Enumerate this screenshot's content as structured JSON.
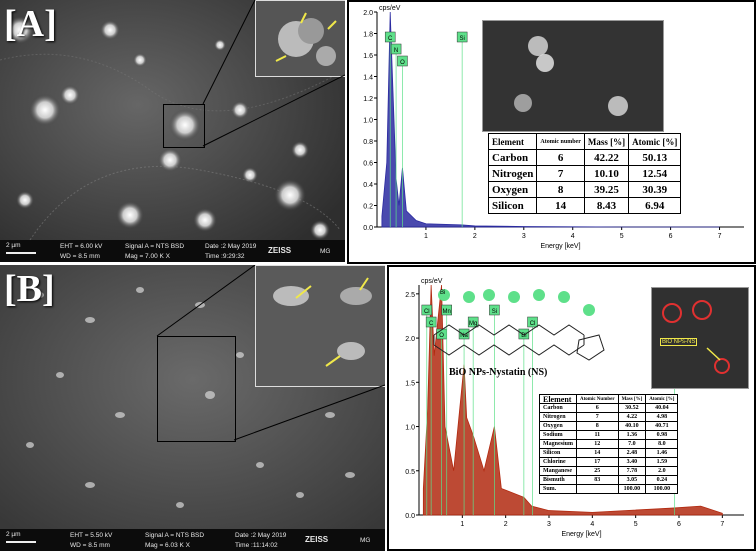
{
  "panel_a": {
    "label": "[A]",
    "sem": {
      "scale": "2 µm",
      "eht": "EHT = 6.00 kV",
      "wd": "WD = 8.5 mm",
      "signal": "Signal A = NTS BSD",
      "mag": "Mag = 7.00 K X",
      "date": "Date :2 May 2019",
      "time": "Time :9:29:32",
      "brand": "ZEISS",
      "user": "MG"
    },
    "eds": {
      "ylabel": "cps/eV",
      "xlabel": "Energy [keV]",
      "peaks": [
        "C",
        "N",
        "O",
        "Si"
      ],
      "table": {
        "headers": [
          "Element",
          "Atomic number",
          "Mass [%]",
          "Atomic [%]"
        ],
        "rows": [
          [
            "Carbon",
            "6",
            "42.22",
            "50.13"
          ],
          [
            "Nitrogen",
            "7",
            "10.10",
            "12.54"
          ],
          [
            "Oxygen",
            "8",
            "39.25",
            "30.39"
          ],
          [
            "Silicon",
            "14",
            "8.43",
            "6.94"
          ]
        ]
      }
    }
  },
  "panel_b": {
    "label": "[B]",
    "sem": {
      "scale": "2 µm",
      "eht": "EHT = 5.50 kV",
      "wd": "WD = 8.5 mm",
      "signal": "Signal A = NTS BSD",
      "mag": "Mag = 6.03 K X",
      "date": "Date :2 May 2019",
      "time": "Time :11:14:02",
      "brand": "ZEISS",
      "user": "MG"
    },
    "eds": {
      "ylabel": "cps/eV",
      "xlabel": "Energy [keV]",
      "peaks": [
        "Cl",
        "C",
        "O",
        "Mn",
        "Mg",
        "Na",
        "Si",
        "Cl",
        "Bi",
        "Mn"
      ],
      "molecule_title": "BiO NPs-Nystatin (NS)",
      "molecule_atom": "Bi",
      "inset_label": "BiO NPs-NS",
      "table": {
        "headers": [
          "Element",
          "Atomic Number",
          "Mass [%]",
          "Atomic [%]"
        ],
        "rows": [
          [
            "Carbon",
            "6",
            "30.52",
            "40.04"
          ],
          [
            "Nitrogen",
            "7",
            "4.22",
            "4.98"
          ],
          [
            "Oxygen",
            "8",
            "40.10",
            "40.71"
          ],
          [
            "Sodium",
            "11",
            "1.36",
            "0.98"
          ],
          [
            "Magnesium",
            "12",
            "7.0",
            "8.0"
          ],
          [
            "Silicon",
            "14",
            "2.48",
            "1.46"
          ],
          [
            "Chlorine",
            "17",
            "3.40",
            "1.59"
          ],
          [
            "Manganese",
            "25",
            "7.78",
            "2.0"
          ],
          [
            "Bismuth",
            "83",
            "3.05",
            "0.24"
          ],
          [
            "Sum.",
            "",
            "100.00",
            "100.00"
          ]
        ]
      }
    }
  },
  "chart_data": [
    {
      "type": "area",
      "ylabel": "cps/eV",
      "xlabel": "Energy [keV]",
      "xlim": [
        0,
        7.5
      ],
      "ylim": [
        0,
        2.0
      ],
      "x_ticks": [
        1,
        2,
        3,
        4,
        5,
        6,
        7
      ],
      "y_ticks": [
        0.0,
        0.2,
        0.4,
        0.6,
        0.8,
        1.0,
        1.2,
        1.4,
        1.6,
        1.8,
        2.0
      ],
      "series": [
        {
          "x": [
            0.1,
            0.2,
            0.27,
            0.3,
            0.39,
            0.45,
            0.52,
            0.6,
            0.8,
            1.0,
            1.74,
            2.0,
            3.0,
            5.0,
            7.0
          ],
          "y": [
            0.1,
            0.6,
            2.0,
            1.6,
            0.45,
            0.2,
            0.55,
            0.15,
            0.06,
            0.03,
            0.02,
            0.01,
            0.005,
            0.0,
            0.0
          ]
        }
      ],
      "peak_labels": [
        {
          "label": "C",
          "x": 0.27
        },
        {
          "label": "N",
          "x": 0.39
        },
        {
          "label": "O",
          "x": 0.52
        },
        {
          "label": "Si",
          "x": 1.74
        }
      ]
    },
    {
      "type": "area",
      "ylabel": "cps/eV",
      "xlabel": "Energy [keV]",
      "xlim": [
        0,
        7.5
      ],
      "ylim": [
        0,
        2.6
      ],
      "x_ticks": [
        1,
        2,
        3,
        4,
        5,
        6,
        7
      ],
      "y_ticks": [
        0.0,
        0.5,
        1.0,
        1.5,
        2.0,
        2.5
      ],
      "series": [
        {
          "x": [
            0.1,
            0.2,
            0.28,
            0.35,
            0.52,
            0.6,
            0.64,
            0.8,
            1.04,
            1.1,
            1.25,
            1.5,
            1.74,
            1.9,
            2.42,
            2.6,
            3.0,
            4.0,
            5.9,
            6.5,
            7.0
          ],
          "y": [
            0.3,
            1.2,
            2.6,
            1.8,
            2.6,
            1.0,
            0.9,
            0.5,
            1.7,
            1.1,
            0.9,
            0.5,
            1.0,
            0.3,
            0.2,
            0.1,
            0.05,
            0.03,
            0.08,
            0.1,
            0.02
          ]
        }
      ],
      "peak_labels": [
        {
          "label": "Cl",
          "x": 0.18
        },
        {
          "label": "C",
          "x": 0.28
        },
        {
          "label": "O",
          "x": 0.52
        },
        {
          "label": "Mn",
          "x": 0.64
        },
        {
          "label": "Mg",
          "x": 1.25
        },
        {
          "label": "Na",
          "x": 1.04
        },
        {
          "label": "Si",
          "x": 1.74
        },
        {
          "label": "Cl",
          "x": 2.62
        },
        {
          "label": "Bi",
          "x": 2.42
        },
        {
          "label": "Mn",
          "x": 5.9
        }
      ]
    }
  ],
  "colors": {
    "spectrum_a": "#2a2aa0",
    "spectrum_b": "#b22a10",
    "peak_box": "#5ee08a",
    "arrow": "#f0e84a"
  }
}
